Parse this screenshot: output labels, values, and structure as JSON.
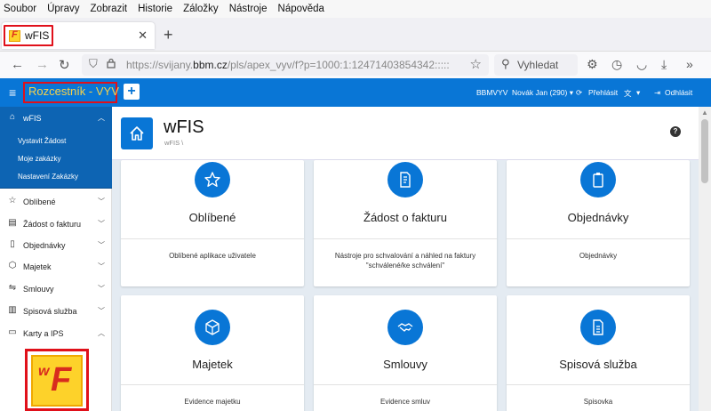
{
  "menubar": [
    "Soubor",
    "Úpravy",
    "Zobrazit",
    "Historie",
    "Záložky",
    "Nástroje",
    "Nápověda"
  ],
  "browser": {
    "tab_title": "wFIS",
    "url_prefix": "https://svijany.",
    "url_domain": "bbm.cz",
    "url_rest": "/pls/apex_vyv/f?p=1000:1:12471403854342:::::",
    "search_placeholder": "Vyhledat"
  },
  "header": {
    "app_title": "Rozcestník - VYV",
    "db": "BBMVYV",
    "user": "Novák Jan (290) ▾",
    "switch_login": "Přehlásit",
    "language": "▾",
    "logout": "Odhlásit"
  },
  "sidebar": {
    "active": {
      "label": "wFIS",
      "subitems": [
        "Vystavit Žádost",
        "Moje zakázky",
        "Nastavení Zakázky"
      ]
    },
    "items": [
      {
        "label": "Oblíbené",
        "icon": "star-icon"
      },
      {
        "label": "Žádost o fakturu",
        "icon": "invoice-icon"
      },
      {
        "label": "Objednávky",
        "icon": "clipboard-icon"
      },
      {
        "label": "Majetek",
        "icon": "cube-icon"
      },
      {
        "label": "Smlouvy",
        "icon": "handshake-icon"
      },
      {
        "label": "Spisová služba",
        "icon": "document-icon"
      },
      {
        "label": "Karty a IPS",
        "icon": "card-icon"
      }
    ]
  },
  "page": {
    "title": "wFIS",
    "breadcrumb": "wFIS \\"
  },
  "cards": [
    {
      "title": "Oblíbené",
      "desc": "Oblíbené aplikace uživatele"
    },
    {
      "title": "Žádost o fakturu",
      "desc": "Nástroje pro schvalování a náhled na faktury \"schválené/ke schválení\""
    },
    {
      "title": "Objednávky",
      "desc": "Objednávky"
    },
    {
      "title": "Majetek",
      "desc": "Evidence majetku"
    },
    {
      "title": "Smlouvy",
      "desc": "Evidence smluv"
    },
    {
      "title": "Spisová služba",
      "desc": "Spisovka"
    }
  ],
  "colors": {
    "brand_blue": "#0976d6",
    "sidebar_active": "#0d64b3",
    "highlight_red": "#e0101a",
    "title_yellow": "#f6d24a"
  }
}
